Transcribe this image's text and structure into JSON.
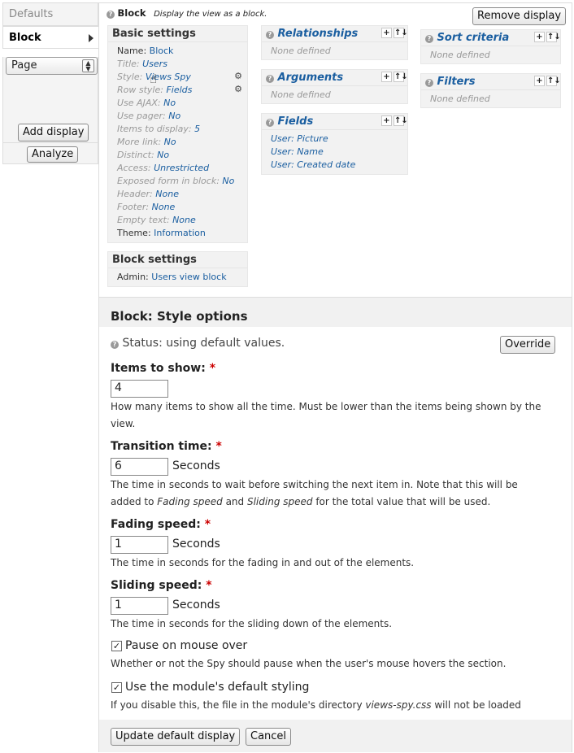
{
  "tabs": {
    "defaults": "Defaults",
    "block": "Block"
  },
  "left": {
    "select_value": "Page",
    "add_display": "Add display",
    "analyze": "Analyze"
  },
  "header": {
    "name": "Block",
    "desc": "Display the view as a block.",
    "remove": "Remove display"
  },
  "basic": {
    "title": "Basic settings",
    "rows": [
      {
        "label": "Name:",
        "value": "Block",
        "style": "normal"
      },
      {
        "label": "Title:",
        "value": "Users"
      },
      {
        "label": "Style:",
        "value": "Views Spy"
      },
      {
        "label": "Row style:",
        "value": "Fields"
      },
      {
        "label": "Use AJAX:",
        "value": "No"
      },
      {
        "label": "Use pager:",
        "value": "No"
      },
      {
        "label": "Items to display:",
        "value": "5"
      },
      {
        "label": "More link:",
        "value": "No"
      },
      {
        "label": "Distinct:",
        "value": "No"
      },
      {
        "label": "Access:",
        "value": "Unrestricted"
      },
      {
        "label": "Exposed form in block:",
        "value": "No"
      },
      {
        "label": "Header:",
        "value": "None"
      },
      {
        "label": "Footer:",
        "value": "None"
      },
      {
        "label": "Empty text:",
        "value": "None"
      },
      {
        "label": "Theme:",
        "value": "Information",
        "style": "normal"
      }
    ]
  },
  "block_settings": {
    "title": "Block settings",
    "label": "Admin:",
    "value": "Users view block"
  },
  "relationships": {
    "title": "Relationships",
    "empty": "None defined"
  },
  "arguments": {
    "title": "Arguments",
    "empty": "None defined"
  },
  "fields": {
    "title": "Fields",
    "items": [
      "User: Picture",
      "User: Name",
      "User: Created date"
    ]
  },
  "sort": {
    "title": "Sort criteria",
    "empty": "None defined"
  },
  "filters": {
    "title": "Filters",
    "empty": "None defined"
  },
  "icons": {
    "add": "+",
    "rearrange": "↑↓",
    "gear": "⚙",
    "help": "?"
  },
  "style_options": {
    "title": "Block: Style options",
    "status": "Status: using default values.",
    "override": "Override",
    "items_to_show": {
      "label": "Items to show:",
      "value": "4",
      "desc": "How many items to show all the time. Must be lower than the items being shown by the",
      "desc2": "view."
    },
    "transition": {
      "label": "Transition time:",
      "value": "6",
      "unit": "Seconds",
      "desc_a": "The time in seconds to wait before switching the next item in. Note that this will be",
      "desc_b1": "added to ",
      "desc_b2": "Fading speed",
      "desc_b3": " and ",
      "desc_b4": "Sliding speed",
      "desc_b5": " for the total value that will be used."
    },
    "fading": {
      "label": "Fading speed:",
      "value": "1",
      "unit": "Seconds",
      "desc": "The time in seconds for the fading in and out of the elements."
    },
    "sliding": {
      "label": "Sliding speed:",
      "value": "1",
      "unit": "Seconds",
      "desc": "The time in seconds for the sliding down of the elements."
    },
    "pause": {
      "label": "Pause on mouse over",
      "checked": true,
      "desc": "Whether or not the Spy should pause when the user's mouse hovers the section."
    },
    "default_styling": {
      "label": "Use the module's default styling",
      "checked": true,
      "desc1": "If you disable this, the file in the module's directory ",
      "desc_file": "views-spy.css",
      "desc2": " will not be loaded"
    },
    "required_mark": "*",
    "update": "Update default display",
    "cancel": "Cancel"
  }
}
